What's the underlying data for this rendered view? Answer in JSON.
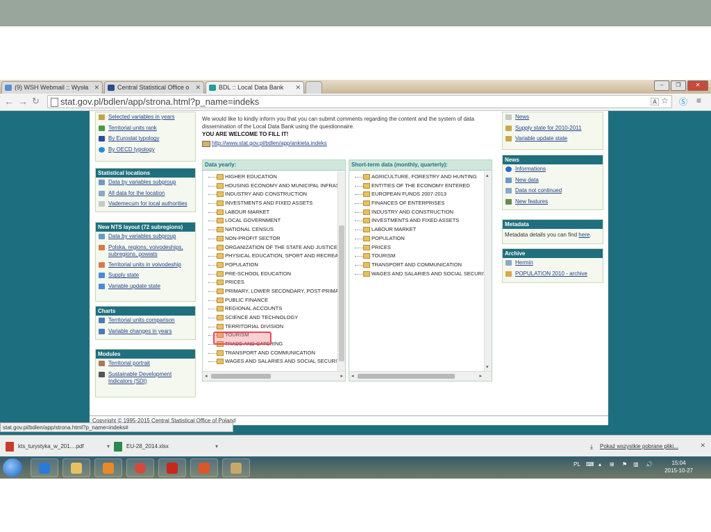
{
  "browser": {
    "tabs": [
      {
        "label": "(9) WSH Webmail :: Wysła",
        "active": false
      },
      {
        "label": "Central Statistical Office o",
        "active": false
      },
      {
        "label": "BDL :: Local Data Bank",
        "active": true
      }
    ],
    "url": "stat.gov.pl/bdlen/app/strona.html?p_name=indeks",
    "status_url": "stat.gov.pl/bdlen/app/strona.html?p_name=indeks#"
  },
  "left": {
    "top_items": [
      "Selected variables in years",
      "Territorial units rank",
      "By Eurostat typology",
      "By OECD typology"
    ],
    "statistical_locations": {
      "title": "Statistical locations",
      "items": [
        "Data by variables subgroup",
        "All data for the location",
        "Vademecum for local authorities"
      ]
    },
    "nts": {
      "title": "New NTS layout (72 subregions)",
      "items": [
        "Data by variables subgroup",
        "Polska, regions, voivodeships, subregions, powiats",
        "Territorial units in voivodeship",
        "Supply state",
        "Variable update state"
      ]
    },
    "charts": {
      "title": "Charts",
      "items": [
        "Territorial units comparison",
        "Variable changes in years"
      ]
    },
    "modules": {
      "title": "Modules",
      "items": [
        "Territorial portrait",
        "Sustainable Development Indicators (SDI)"
      ]
    }
  },
  "notice": {
    "text": "We would like to kindly inform you that you can submit comments regarding the content and the system of data dissemination of the Local Data Bank using the questionnaire.",
    "strong": "YOU ARE WELCOME TO FILL IT!",
    "link": "http://www.stat.gov.pl/bdlen/app/ankieta.indeks"
  },
  "yearly": {
    "title": "Data yearly:",
    "items": [
      "HIGHER EDUCATION",
      "HOUSING ECONOMY AND MUNICIPAL INFRAS",
      "INDUSTRY AND CONSTRUCTION",
      "INVESTMENTS AND FIXED ASSETS",
      "LABOUR MARKET",
      "LOCAL GOVERNMENT",
      "NATIONAL CENSUS",
      "NON-PROFIT SECTOR",
      "ORGANIZATION OF THE STATE AND JUSTICE",
      "PHYSICAL EDUCATION, SPORT AND RECREAT",
      "POPULATION",
      "PRE-SCHOOL EDUCATION",
      "PRICES",
      "PRIMARY, LOWER SECONDARY, POST-PRIMA",
      "PUBLIC FINANCE",
      "REGIONAL ACCOUNTS",
      "SCIENCE AND TECHNOLOGY",
      "TERRITORIAL DIVISION",
      "TOURISM",
      "TRADE AND CATERING",
      "TRANSPORT AND COMMUNICATION",
      "WAGES AND SALARIES AND SOCIAL SECURIT"
    ]
  },
  "shortterm": {
    "title": "Short-term data (monthly, quarterly):",
    "items": [
      "AGRICULTURE, FORESTRY AND HUNTING",
      "ENTITIES OF THE ECONOMY ENTERED",
      "EUROPEAN FUNDS 2007-2013",
      "FINANCES OF ENTERPRISES",
      "INDUSTRY AND CONSTRUCTION",
      "INVESTMENTS AND FIXED ASSETS",
      "LABOUR MARKET",
      "POPULATION",
      "PRICES",
      "TOURISM",
      "TRANSPORT AND COMMUNICATION",
      "WAGES AND SALARIES AND SOCIAL SECURIT"
    ]
  },
  "right": {
    "top_items": [
      "News",
      "Supply state for 2010-2011",
      "Variable update state"
    ],
    "news": {
      "title": "News",
      "items": [
        "Informations",
        "New data",
        "Data not continued",
        "New features"
      ]
    },
    "metadata": {
      "title": "Metadata",
      "text": "Metadata details you can find ",
      "link": "here",
      "after": "."
    },
    "archive": {
      "title": "Archive",
      "items": [
        "Hermin",
        "POPULATION 2010 - archive"
      ]
    }
  },
  "footer": {
    "copyright": "Copyright © 1995-2015 Central Statistical Office of Poland"
  },
  "downloads": {
    "items": [
      "kts_turystyka_w_201....pdf",
      "EU-28_2014.xlsx"
    ],
    "show_all": "Pokaż wszystkie pobrane pliki..."
  },
  "taskbar": {
    "lang": "PL",
    "time": "15:04",
    "date": "2015-10-27"
  }
}
